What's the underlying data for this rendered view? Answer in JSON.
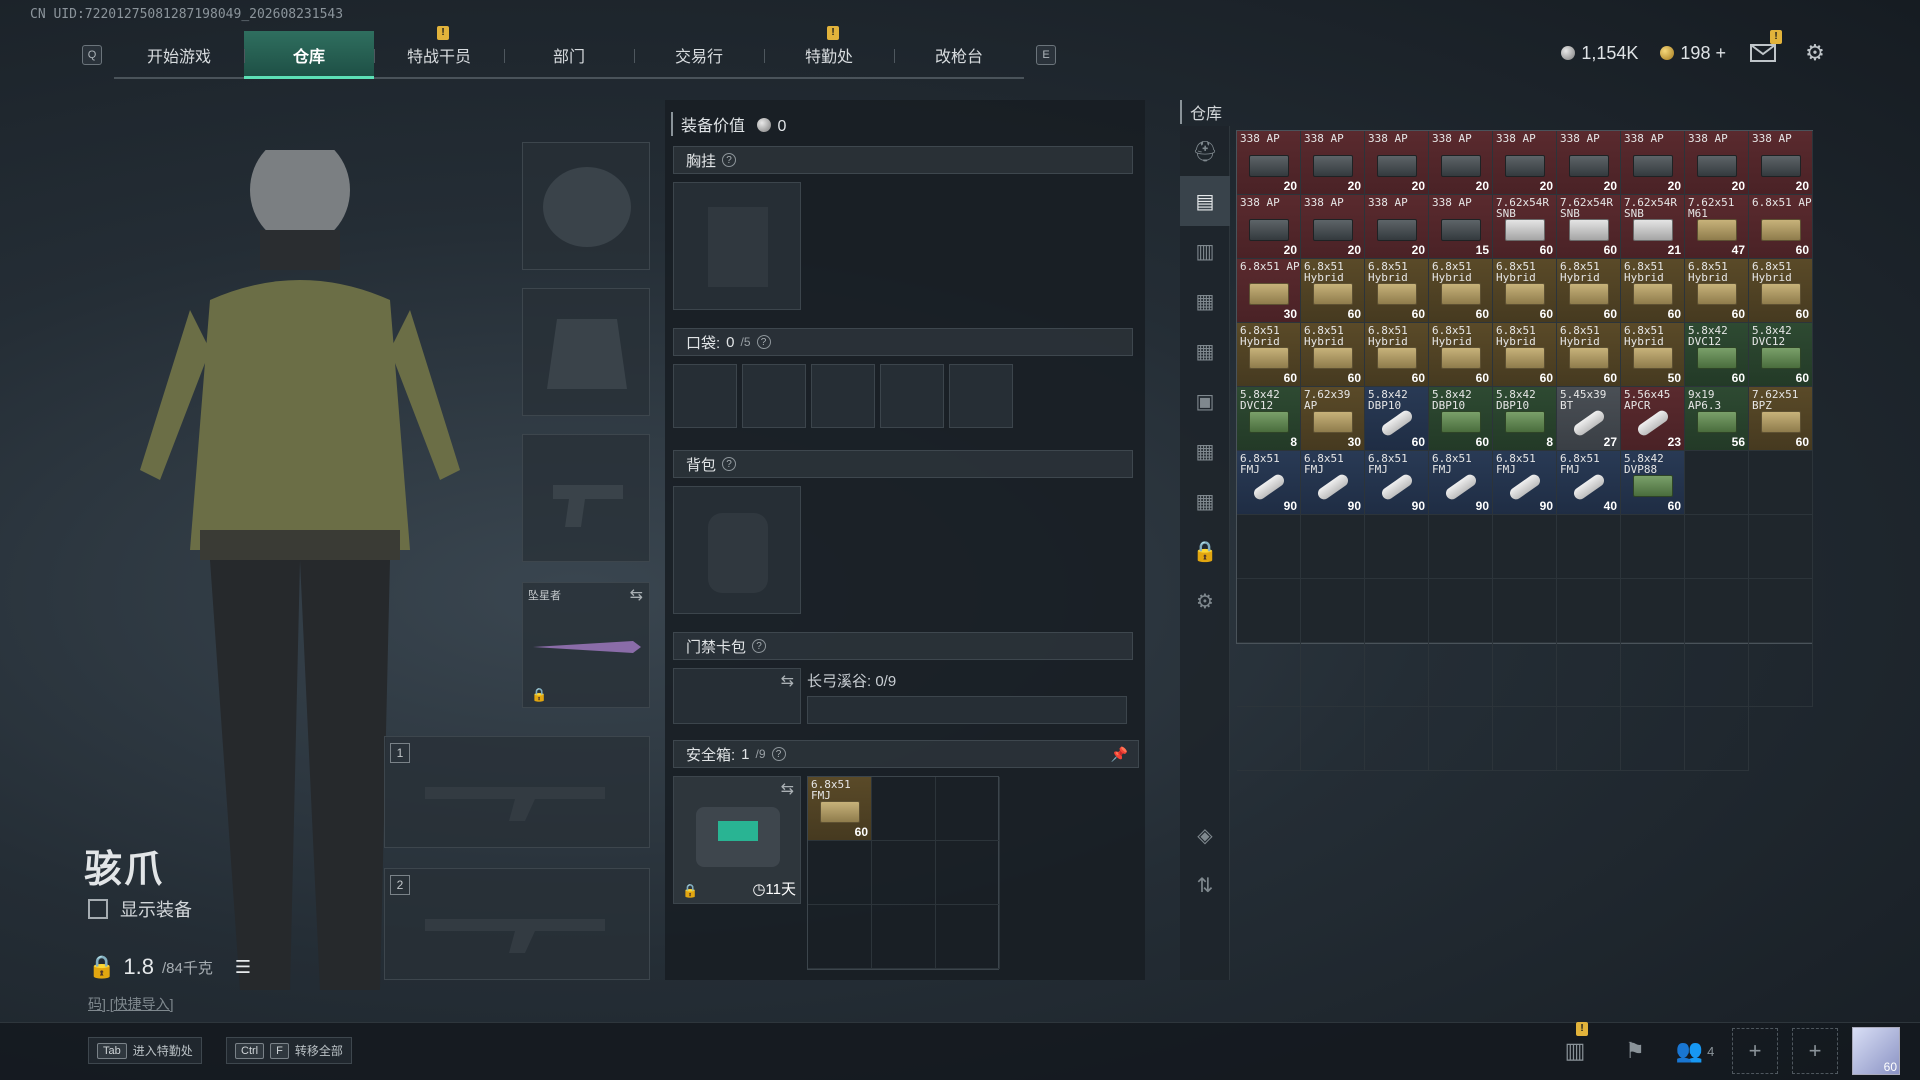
{
  "uid": "CN UID:72201275081287198049_202608231543",
  "nav": {
    "left_key": "Q",
    "right_key": "E",
    "tabs": [
      {
        "label": "开始游戏",
        "active": false,
        "badge": ""
      },
      {
        "label": "仓库",
        "active": true,
        "badge": ""
      },
      {
        "label": "特战干员",
        "active": false,
        "badge": "!"
      },
      {
        "label": "部门",
        "active": false,
        "badge": ""
      },
      {
        "label": "交易行",
        "active": false,
        "badge": ""
      },
      {
        "label": "特勤处",
        "active": false,
        "badge": "!"
      },
      {
        "label": "改枪台",
        "active": false,
        "badge": ""
      }
    ]
  },
  "currency": {
    "silver": "1,154K",
    "gold": "198",
    "plus": "+"
  },
  "mail_badge": "!",
  "character": {
    "name": "骇爪",
    "show_equip": "显示装备",
    "weight": "1.8",
    "weight_max": "/84千克",
    "quick_import": "码] [快捷导入]"
  },
  "slots": {
    "melee_label": "坠星者",
    "weapon1_num": "1",
    "weapon2_num": "2"
  },
  "middle": {
    "equip_value_label": "装备价值",
    "equip_value": "0",
    "chest_label": "胸挂",
    "pocket_label": "口袋:",
    "pocket_count": "0",
    "pocket_max": "/5",
    "backpack_label": "背包",
    "keycard_label": "门禁卡包",
    "keycard_map": "长弓溪谷: 0/9",
    "safebox_label": "安全箱:",
    "safebox_count": "1",
    "safebox_max": "/9",
    "safebox_time": "11天",
    "safebox_item": {
      "name": "6.8x51 FMJ",
      "qty": "60"
    }
  },
  "warehouse": {
    "title": "仓库",
    "items": [
      {
        "n": "338 AP",
        "q": "20",
        "c": "red",
        "a": "box-dark"
      },
      {
        "n": "338 AP",
        "q": "20",
        "c": "red",
        "a": "box-dark"
      },
      {
        "n": "338 AP",
        "q": "20",
        "c": "red",
        "a": "box-dark"
      },
      {
        "n": "338 AP",
        "q": "20",
        "c": "red",
        "a": "box-dark"
      },
      {
        "n": "338 AP",
        "q": "20",
        "c": "red",
        "a": "box-dark"
      },
      {
        "n": "338 AP",
        "q": "20",
        "c": "red",
        "a": "box-dark"
      },
      {
        "n": "338 AP",
        "q": "20",
        "c": "red",
        "a": "box-dark"
      },
      {
        "n": "338 AP",
        "q": "20",
        "c": "red",
        "a": "box-dark"
      },
      {
        "n": "338 AP",
        "q": "20",
        "c": "red",
        "a": "box-dark"
      },
      {
        "n": "338 AP",
        "q": "20",
        "c": "red",
        "a": "box-dark"
      },
      {
        "n": "338 AP",
        "q": "20",
        "c": "red",
        "a": "box-dark"
      },
      {
        "n": "338 AP",
        "q": "20",
        "c": "red",
        "a": "box-dark"
      },
      {
        "n": "338 AP",
        "q": "15",
        "c": "red",
        "a": "box-dark"
      },
      {
        "n": "7.62x54R SNB",
        "q": "60",
        "c": "red",
        "a": "box-white"
      },
      {
        "n": "7.62x54R SNB",
        "q": "60",
        "c": "red",
        "a": "box-white"
      },
      {
        "n": "7.62x54R SNB",
        "q": "21",
        "c": "red",
        "a": "box-white"
      },
      {
        "n": "7.62x51 M61",
        "q": "47",
        "c": "red",
        "a": "box-tan"
      },
      {
        "n": "6.8x51 AP",
        "q": "60",
        "c": "red",
        "a": "box-tan"
      },
      {
        "n": "6.8x51 AP",
        "q": "30",
        "c": "red",
        "a": "box-tan"
      },
      {
        "n": "6.8x51 Hybrid",
        "q": "60",
        "c": "gold",
        "a": "box-tan"
      },
      {
        "n": "6.8x51 Hybrid",
        "q": "60",
        "c": "gold",
        "a": "box-tan"
      },
      {
        "n": "6.8x51 Hybrid",
        "q": "60",
        "c": "gold",
        "a": "box-tan"
      },
      {
        "n": "6.8x51 Hybrid",
        "q": "60",
        "c": "gold",
        "a": "box-tan"
      },
      {
        "n": "6.8x51 Hybrid",
        "q": "60",
        "c": "gold",
        "a": "box-tan"
      },
      {
        "n": "6.8x51 Hybrid",
        "q": "60",
        "c": "gold",
        "a": "box-tan"
      },
      {
        "n": "6.8x51 Hybrid",
        "q": "60",
        "c": "gold",
        "a": "box-tan"
      },
      {
        "n": "6.8x51 Hybrid",
        "q": "60",
        "c": "gold",
        "a": "box-tan"
      },
      {
        "n": "6.8x51 Hybrid",
        "q": "60",
        "c": "gold",
        "a": "box-tan"
      },
      {
        "n": "6.8x51 Hybrid",
        "q": "60",
        "c": "gold",
        "a": "box-tan"
      },
      {
        "n": "6.8x51 Hybrid",
        "q": "60",
        "c": "gold",
        "a": "box-tan"
      },
      {
        "n": "6.8x51 Hybrid",
        "q": "60",
        "c": "gold",
        "a": "box-tan"
      },
      {
        "n": "6.8x51 Hybrid",
        "q": "60",
        "c": "gold",
        "a": "box-tan"
      },
      {
        "n": "6.8x51 Hybrid",
        "q": "60",
        "c": "gold",
        "a": "box-tan"
      },
      {
        "n": "6.8x51 Hybrid",
        "q": "50",
        "c": "gold",
        "a": "box-tan"
      },
      {
        "n": "5.8x42 DVC12",
        "q": "60",
        "c": "green",
        "a": "box-green"
      },
      {
        "n": "5.8x42 DVC12",
        "q": "60",
        "c": "green",
        "a": "box-green"
      },
      {
        "n": "5.8x42 DVC12",
        "q": "8",
        "c": "green",
        "a": "box-green"
      },
      {
        "n": "7.62x39 AP",
        "q": "30",
        "c": "gold",
        "a": "box-tan"
      },
      {
        "n": "5.8x42 DBP10",
        "q": "60",
        "c": "blue",
        "a": "shell"
      },
      {
        "n": "5.8x42 DBP10",
        "q": "60",
        "c": "green",
        "a": "box-green"
      },
      {
        "n": "5.8x42 DBP10",
        "q": "8",
        "c": "green",
        "a": "box-green"
      },
      {
        "n": "5.45x39 BT",
        "q": "27",
        "c": "grey",
        "a": "shell"
      },
      {
        "n": "5.56x45 APCR",
        "q": "23",
        "c": "red",
        "a": "shell"
      },
      {
        "n": "9x19 AP6.3",
        "q": "56",
        "c": "green",
        "a": "box-green"
      },
      {
        "n": "7.62x51 BPZ",
        "q": "60",
        "c": "gold",
        "a": "box-tan"
      },
      {
        "n": "6.8x51 FMJ",
        "q": "90",
        "c": "blue",
        "a": "shell"
      },
      {
        "n": "6.8x51 FMJ",
        "q": "90",
        "c": "blue",
        "a": "shell"
      },
      {
        "n": "6.8x51 FMJ",
        "q": "90",
        "c": "blue",
        "a": "shell"
      },
      {
        "n": "6.8x51 FMJ",
        "q": "90",
        "c": "blue",
        "a": "shell"
      },
      {
        "n": "6.8x51 FMJ",
        "q": "90",
        "c": "blue",
        "a": "shell"
      },
      {
        "n": "6.8x51 FMJ",
        "q": "40",
        "c": "blue",
        "a": "shell"
      },
      {
        "n": "5.8x42 DVP88",
        "q": "60",
        "c": "blue",
        "a": "box-green"
      }
    ],
    "empty_cells": 37
  },
  "bottom": {
    "hint1_key": "Tab",
    "hint1_label": "进入特勤处",
    "hint2_key1": "Ctrl",
    "hint2_key2": "F",
    "hint2_label": "转移全部",
    "friends_count": "4",
    "avatar_level": "60"
  },
  "colors": {
    "accent": "#5de0b6",
    "badge": "#e2b33b"
  }
}
